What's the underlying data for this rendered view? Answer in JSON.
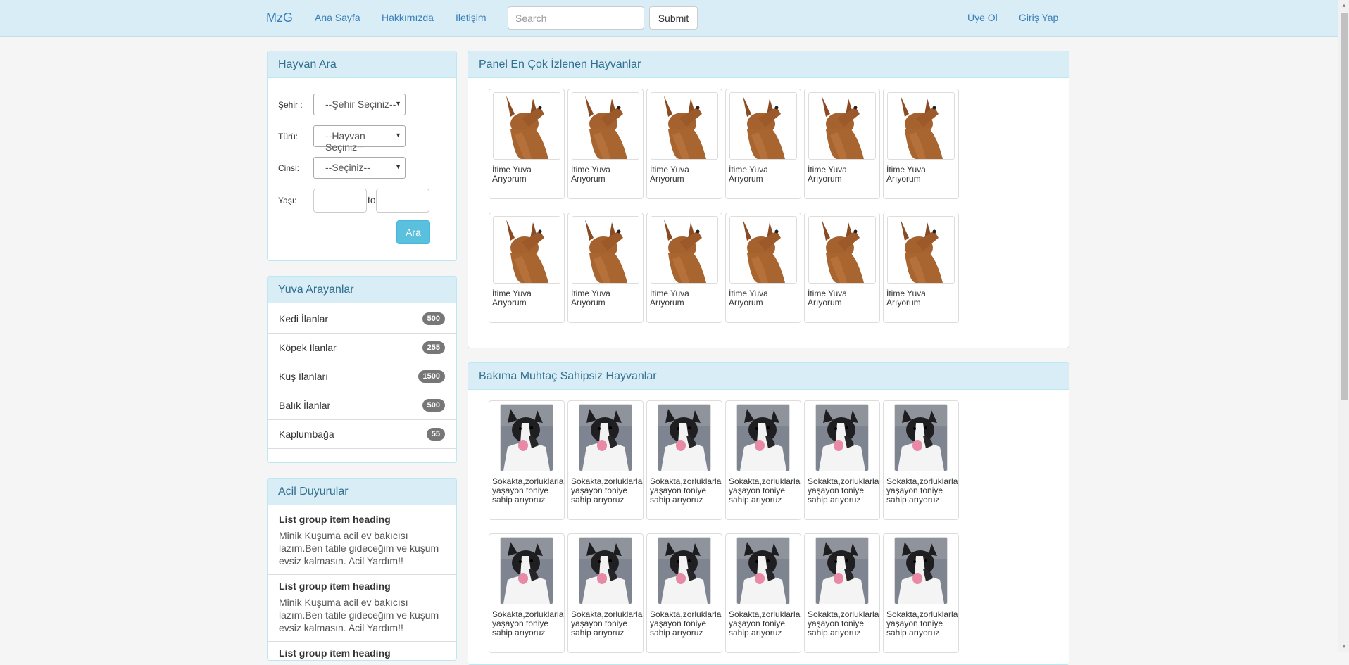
{
  "navbar": {
    "brand": "MzG",
    "links": [
      "Ana Sayfa",
      "Hakkımızda",
      "İletişim"
    ],
    "search_placeholder": "Search",
    "submit_label": "Submit",
    "register": "Üye Ol",
    "login": "Giriş Yap"
  },
  "search_panel": {
    "title": "Hayvan Ara",
    "city_label": "Şehir :",
    "city_value": "--Şehir Seçiniz--",
    "type_label": "Türü:",
    "type_value": "--Hayvan Seçiniz--",
    "breed_label": "Cinsi:",
    "breed_value": "--Seçiniz--",
    "age_label": "Yaşı:",
    "age_to": "to",
    "button": "Ara"
  },
  "home_seekers": {
    "title": "Yuva Arayanlar",
    "items": [
      {
        "label": "Kedi İlanlar",
        "count": "500"
      },
      {
        "label": "Köpek İlanlar",
        "count": "255"
      },
      {
        "label": "Kuş İlanları",
        "count": "1500"
      },
      {
        "label": "Balık İlanlar",
        "count": "500"
      },
      {
        "label": "Kaplumbağa",
        "count": "55"
      }
    ]
  },
  "urgent": {
    "title": "Acil Duyurular",
    "items": [
      {
        "heading": "List group item heading",
        "text": "Minik Kuşuma acil ev bakıcısı lazım.Ben tatile gideceğim ve kuşum evsiz kalmasın. Acil Yardım!!"
      },
      {
        "heading": "List group item heading",
        "text": "Minik Kuşuma acil ev bakıcısı lazım.Ben tatile gideceğim ve kuşum evsiz kalmasın. Acil Yardım!!"
      },
      {
        "heading": "List group item heading",
        "text": ""
      }
    ]
  },
  "popular": {
    "title": "Panel En Çok İzlenen Hayvanlar",
    "caption": "İtime Yuva Arıyorum",
    "count": 12
  },
  "needy": {
    "title": "Bakıma Muhtaç Sahipsiz Hayvanlar",
    "caption": "Sokakta,zorluklarla yaşayon toniye sahip arıyoruz",
    "count": 12
  }
}
